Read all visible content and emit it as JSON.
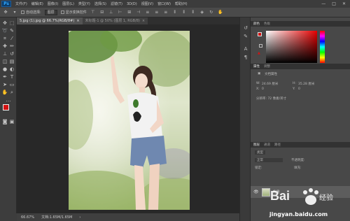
{
  "menubar": {
    "logo": "Ps",
    "items": [
      "文件(F)",
      "编辑(E)",
      "图像(I)",
      "图层(L)",
      "类型(Y)",
      "选择(S)",
      "滤镜(T)",
      "3D(D)",
      "视图(V)",
      "窗口(W)",
      "帮助(H)"
    ],
    "window_controls": [
      "—",
      "□",
      "✕"
    ]
  },
  "options": {
    "auto_select_label": "自动选择:",
    "auto_select_value": "图层",
    "transform_label": "显示变换控件"
  },
  "tabs": [
    {
      "label": "5.jpg (1).jpg @ 66.7%(RGB/8#)",
      "active": true
    },
    {
      "label": "未标题-1 @ 50% (图层 1, RGB/8)",
      "active": false
    }
  ],
  "status": {
    "zoom": "66.67%",
    "doc": "文档:1.65M/1.65M"
  },
  "panels": {
    "color_tabs": [
      "颜色",
      "色板"
    ],
    "properties_tabs": [
      "属性",
      "调整"
    ],
    "properties_title": "文档属性",
    "w_label": "W:",
    "w_value": "24.69 厘米",
    "h_label": "H:",
    "h_value": "35.28 厘米",
    "x_label": "X:",
    "x_value": "0",
    "y_label": "Y:",
    "y_value": "0",
    "resolution": "分辨率: 72 像素/英寸",
    "layers_tabs": [
      "图层",
      "通道",
      "路径"
    ],
    "kind_label": "类型",
    "mode_label": "正常",
    "opacity_label": "不透明度:",
    "lock_label": "锁定:",
    "fill_label": "填充:",
    "layer_name": "背景"
  },
  "watermark": {
    "text": "Bai 百度 经验",
    "url": "jingyan.baidu.com"
  },
  "colors": {
    "foreground": "#d41212",
    "background": "#ffffff"
  }
}
